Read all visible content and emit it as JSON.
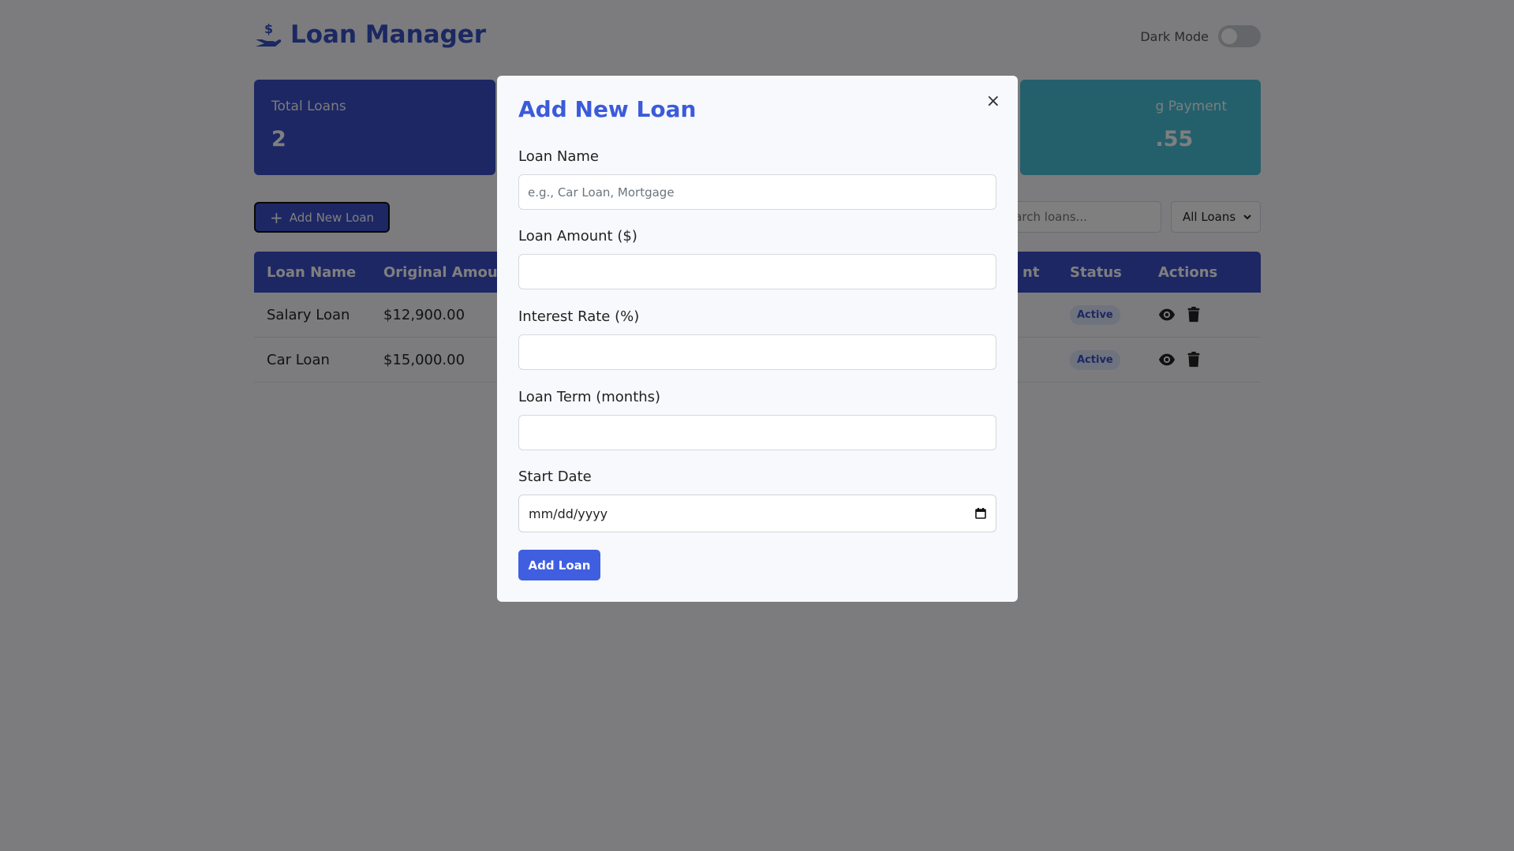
{
  "app": {
    "title": "Loan Manager",
    "logo_icon": "hand-dollar-icon"
  },
  "header": {
    "dark_mode_label": "Dark Mode",
    "dark_mode_on": false
  },
  "stats": [
    {
      "label": "Total Loans",
      "value": "2"
    },
    {
      "label": "",
      "value": ""
    },
    {
      "label": "",
      "value": ""
    },
    {
      "label": "g Payment",
      "value": ".55"
    }
  ],
  "toolbar": {
    "add_button_label": "Add New Loan",
    "search_placeholder": "earch loans...",
    "filter_selected": "All Loans"
  },
  "table": {
    "headers": [
      "Loan Name",
      "Original Amou",
      "",
      "",
      "nt",
      "Status",
      "Actions"
    ],
    "rows": [
      {
        "name": "Salary Loan",
        "amount": "$12,900.00",
        "status": "Active"
      },
      {
        "name": "Car Loan",
        "amount": "$15,000.00",
        "status": "Active"
      }
    ]
  },
  "modal": {
    "title": "Add New Loan",
    "close_symbol": "×",
    "fields": {
      "loan_name": {
        "label": "Loan Name",
        "placeholder": "e.g., Car Loan, Mortgage",
        "value": ""
      },
      "loan_amount": {
        "label": "Loan Amount ($)",
        "value": ""
      },
      "interest_rate": {
        "label": "Interest Rate (%)",
        "value": ""
      },
      "loan_term": {
        "label": "Loan Term (months)",
        "value": ""
      },
      "start_date": {
        "label": "Start Date",
        "value": "mm/dd/yyyy"
      }
    },
    "submit_label": "Add Loan"
  },
  "colors": {
    "primary": "#3b4ec9",
    "accent_teal": "#48c1d9",
    "modal_title": "#3b5bdb",
    "button": "#3f5fe0",
    "overlay": "rgba(0,0,0,0.5)"
  }
}
